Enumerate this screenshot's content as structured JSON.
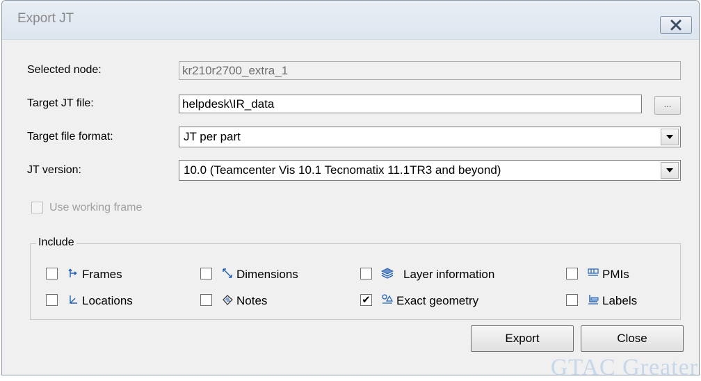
{
  "window": {
    "title": "Export JT"
  },
  "form": {
    "selected_node_label": "Selected node:",
    "selected_node_value": "kr210r2700_extra_1",
    "target_file_label": "Target JT file:",
    "target_file_value": "helpdesk\\IR_data",
    "browse_label": "...",
    "format_label": "Target file format:",
    "format_value": "JT per part",
    "version_label": "JT version:",
    "version_value": "10.0 (Teamcenter Vis 10.1 Tecnomatix 11.1TR3 and beyond)",
    "working_frame_label": "Use working frame",
    "working_frame_checked": false
  },
  "include": {
    "label": "Include",
    "items": [
      {
        "label": "Frames",
        "icon": "frames-icon",
        "checked": false
      },
      {
        "label": "Dimensions",
        "icon": "dimensions-icon",
        "checked": false
      },
      {
        "label": "Layer information",
        "icon": "layer-icon",
        "checked": false
      },
      {
        "label": "PMIs",
        "icon": "pmi-icon",
        "checked": false
      },
      {
        "label": "Locations",
        "icon": "locations-icon",
        "checked": false
      },
      {
        "label": "Notes",
        "icon": "notes-icon",
        "checked": false
      },
      {
        "label": "Exact geometry",
        "icon": "exact-geometry-icon",
        "checked": true
      },
      {
        "label": "Labels",
        "icon": "labels-icon",
        "checked": false
      }
    ]
  },
  "buttons": {
    "export_label": "Export",
    "close_label": "Close"
  },
  "watermark": "GTAC Greater",
  "colors": {
    "dialog_bg": "#f0f0f0",
    "title_text": "#8a8a8a",
    "icon_blue": "#1f5fb4"
  }
}
